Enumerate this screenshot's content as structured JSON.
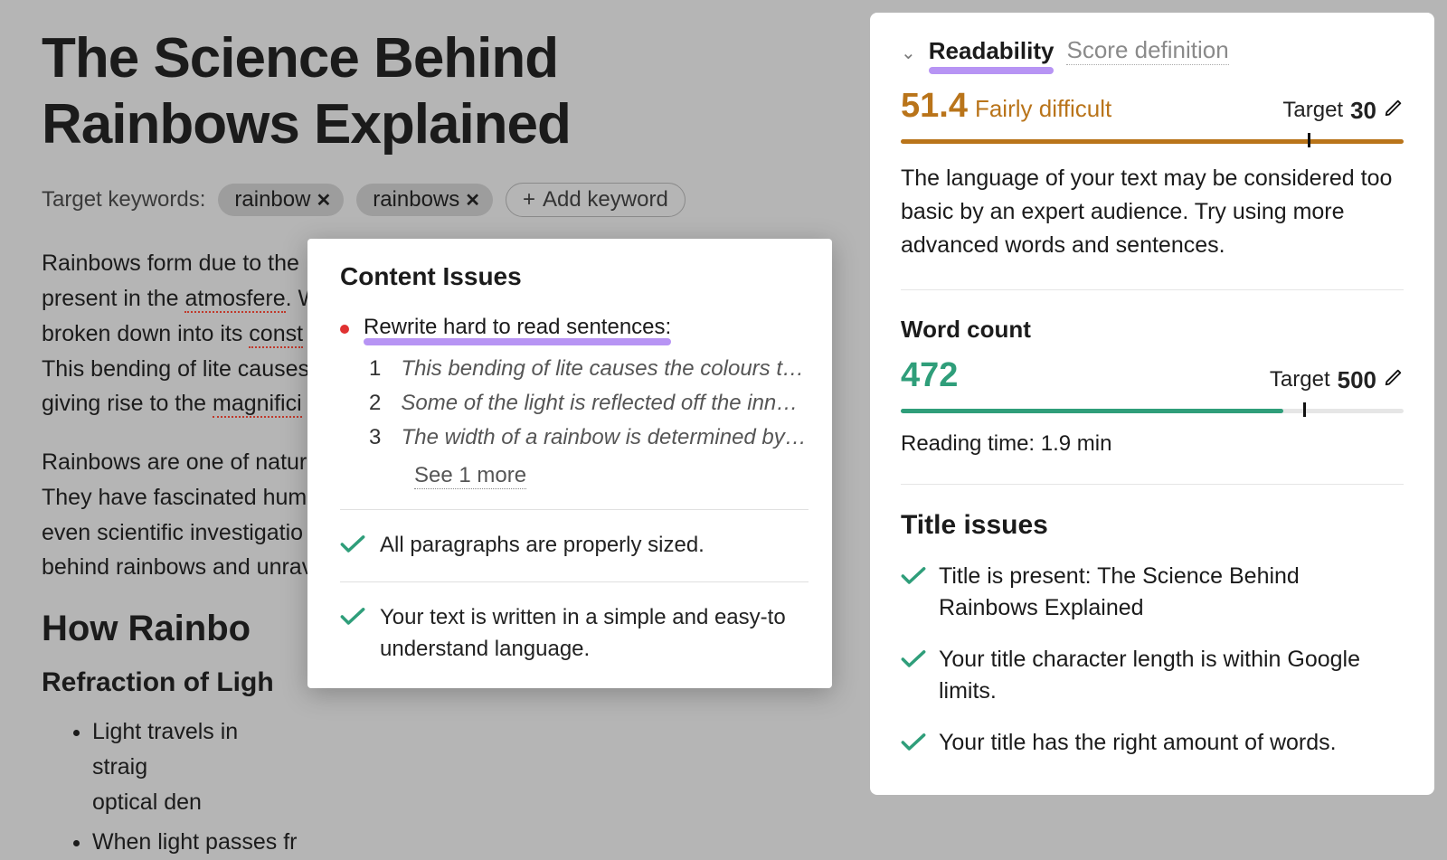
{
  "editor": {
    "title": "The Science Behind Rainbows Explained",
    "keywords_label": "Target keywords:",
    "keywords": [
      "rainbow",
      "rainbows"
    ],
    "add_keyword": "Add keyword",
    "para1_a": "Rainbows form due to the ",
    "para1_b": "present in the ",
    "para1_err1": "atmosfere",
    "para1_c": ". W",
    "para1_d": "broken down into its ",
    "para1_err2": "const",
    "para1_e": "This bending of lite causes",
    "para1_f": "giving rise to the ",
    "para1_err3": "magnifici",
    "para2": "Rainbows are one of nature\nThey have fascinated huma\neven scientific investigatio\nbehind rainbows and unrav",
    "h2": "How Rainbo",
    "h3": "Refraction of Ligh",
    "bullets": [
      "Light travels in straig                                                                                                                          different optical den",
      "When light passes fr"
    ]
  },
  "popover": {
    "title": "Content Issues",
    "issue_title": "Rewrite hard to read sentences:",
    "sentences": [
      "This bending of lite causes the colours to …",
      "Some of the light is reflected off the inner …",
      "The width of a rainbow is determined by t…"
    ],
    "see_more": "See 1 more",
    "pass1": "All paragraphs are properly sized.",
    "pass2": "Your text is written in a simple and easy-to understand language."
  },
  "sidebar": {
    "tab": "Readability",
    "score_definition": "Score definition",
    "readability": {
      "value": "51.4",
      "label": "Fairly difficult",
      "target_label": "Target",
      "target_value": "30",
      "bar_fill_pct": 100,
      "tick_pct": 81,
      "color": "#b9741a",
      "desc": "The language of your text may be considered too basic by an expert audience. Try using more advanced words and sentences."
    },
    "wordcount": {
      "title": "Word count",
      "value": "472",
      "target_label": "Target",
      "target_value": "500",
      "bar_fill_pct": 76,
      "tick_pct": 80,
      "color": "#2f9e7a",
      "reading": "Reading time: 1.9 min"
    },
    "title_issues": {
      "title": "Title issues",
      "items": [
        "Title is present: The Science Behind Rainbows Explained",
        "Your title character length is within Google limits.",
        "Your title has the right amount of words."
      ]
    }
  }
}
